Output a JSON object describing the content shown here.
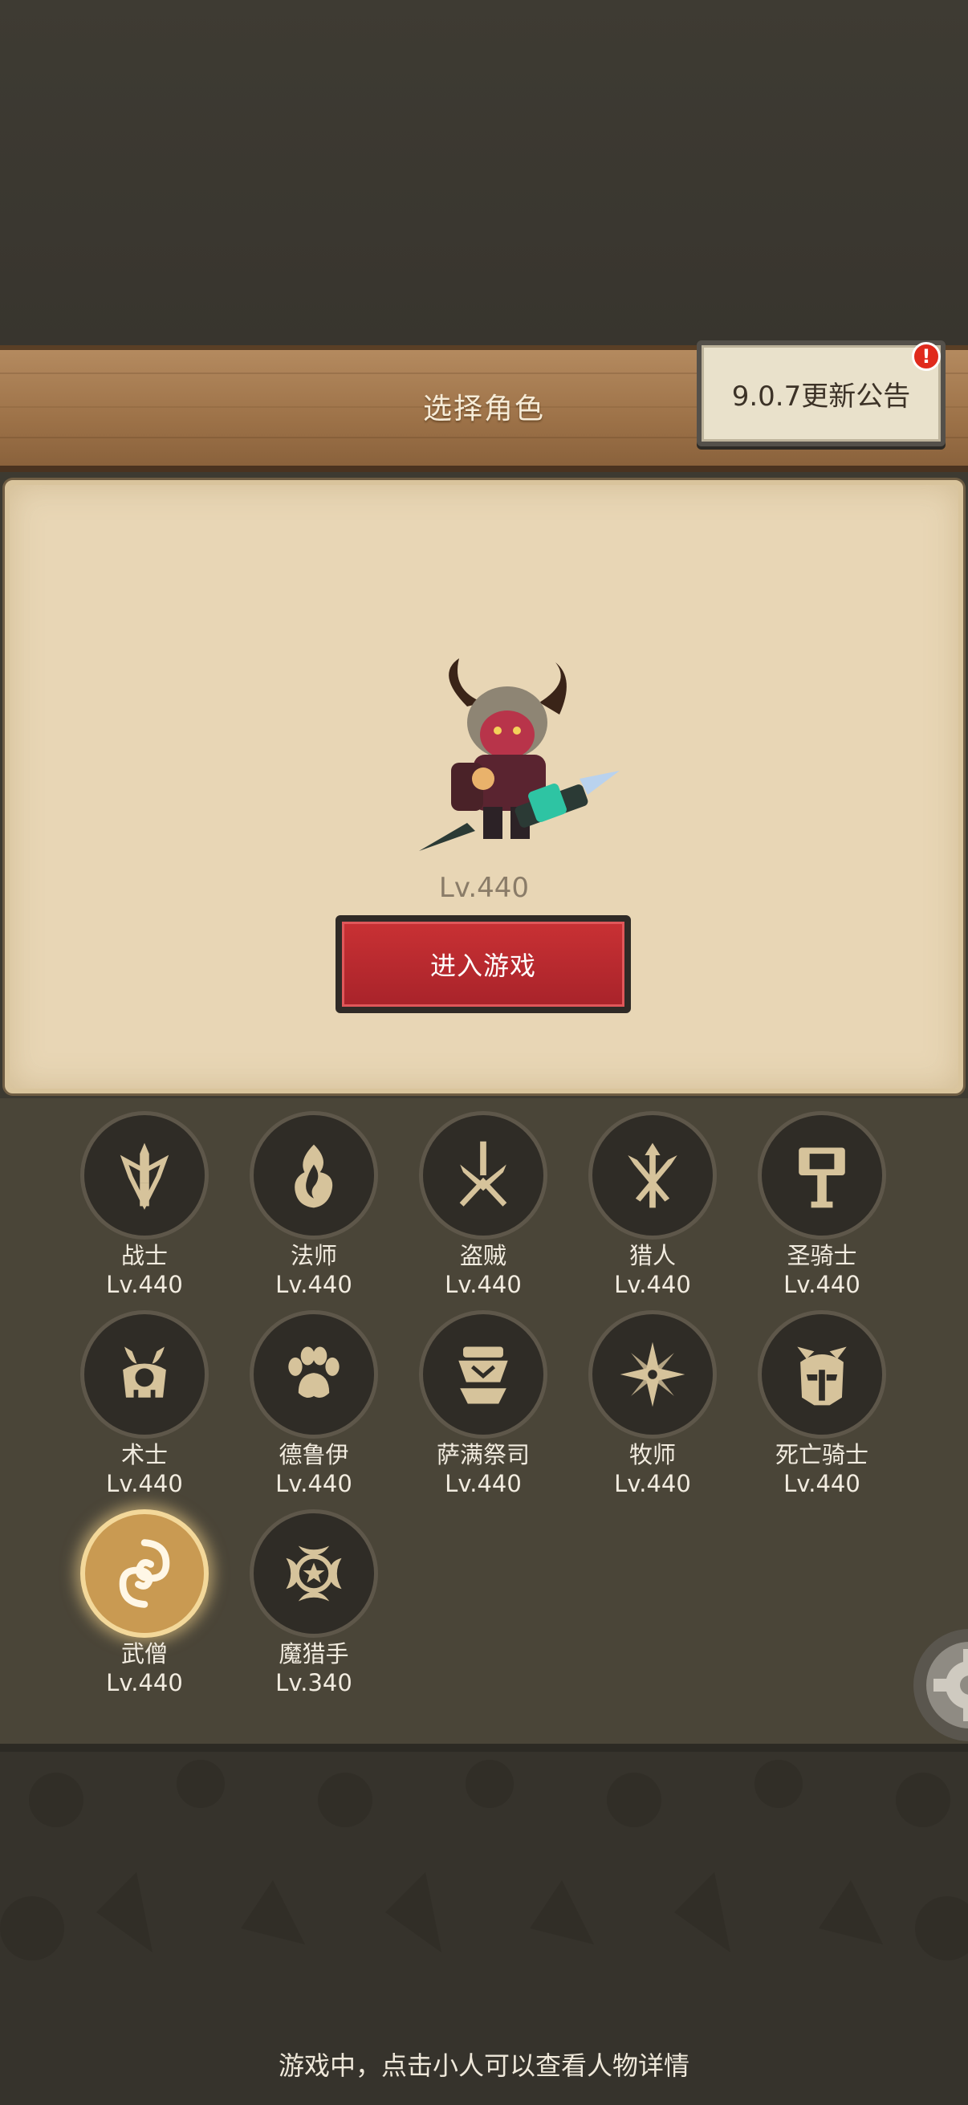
{
  "header": {
    "title": "选择角色",
    "notice_button": "9.0.7更新公告",
    "notice_badge": "!"
  },
  "selected": {
    "level": "Lv.440",
    "enter_button": "进入游戏"
  },
  "classes": [
    {
      "name": "战士",
      "level": "Lv.440",
      "icon": "warrior-sword-icon",
      "selected": false
    },
    {
      "name": "法师",
      "level": "Lv.440",
      "icon": "mage-flame-icon",
      "selected": false
    },
    {
      "name": "盗贼",
      "level": "Lv.440",
      "icon": "rogue-daggers-icon",
      "selected": false
    },
    {
      "name": "猎人",
      "level": "Lv.440",
      "icon": "hunter-arrows-icon",
      "selected": false
    },
    {
      "name": "圣骑士",
      "level": "Lv.440",
      "icon": "paladin-hammer-icon",
      "selected": false
    },
    {
      "name": "术士",
      "level": "Lv.440",
      "icon": "warlock-skull-icon",
      "selected": false
    },
    {
      "name": "德鲁伊",
      "level": "Lv.440",
      "icon": "druid-paw-icon",
      "selected": false
    },
    {
      "name": "萨满祭司",
      "level": "Lv.440",
      "icon": "shaman-totem-icon",
      "selected": false
    },
    {
      "name": "牧师",
      "level": "Lv.440",
      "icon": "priest-star-icon",
      "selected": false
    },
    {
      "name": "死亡骑士",
      "level": "Lv.440",
      "icon": "death-knight-helm-icon",
      "selected": false
    },
    {
      "name": "武僧",
      "level": "Lv.440",
      "icon": "monk-swirl-icon",
      "selected": true
    },
    {
      "name": "魔猎手",
      "level": "Lv.340",
      "icon": "demon-hunter-icon",
      "selected": false
    }
  ],
  "footer": {
    "tip": "游戏中，点击小人可以查看人物详情"
  },
  "colors": {
    "accent_red": "#b8282e",
    "icon_gold": "#d6c39b",
    "selected_glow": "#f3d89a"
  }
}
